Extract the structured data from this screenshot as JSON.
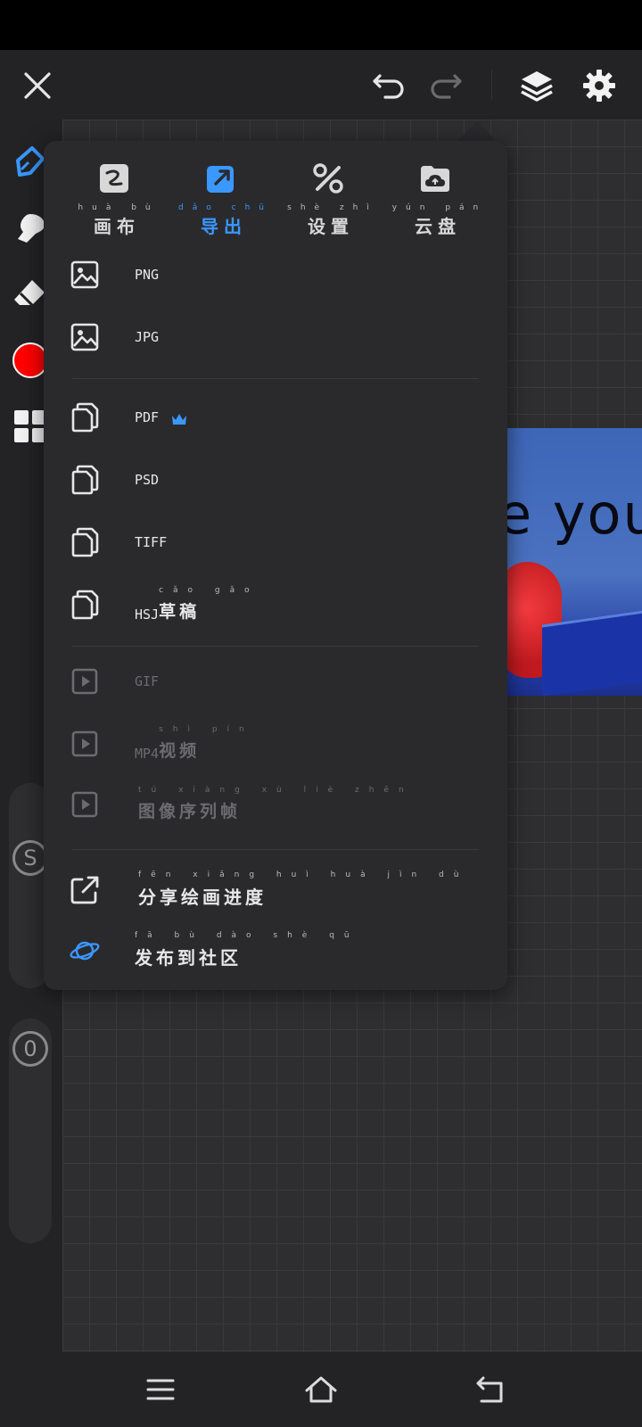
{
  "menu": {
    "tabs": [
      {
        "label": "画布",
        "pinyin": "huà bù",
        "active": false
      },
      {
        "label": "导出",
        "pinyin": "dǎo chū",
        "active": true
      },
      {
        "label": "设置",
        "pinyin": "shè zhì",
        "active": false
      },
      {
        "label": "云盘",
        "pinyin": "yún pán",
        "active": false
      }
    ],
    "items": {
      "png": "PNG",
      "jpg": "JPG",
      "pdf": "PDF",
      "psd": "PSD",
      "tiff": "TIFF",
      "hsj_prefix": "HSJ",
      "hsj_cjk": "草稿",
      "hsj_pinyin": "cǎo gǎo",
      "gif": "GIF",
      "mp4_prefix": "MP4",
      "mp4_cjk": "视频",
      "mp4_pinyin": "shì pín",
      "frames_cjk": "图像序列帧",
      "frames_pinyin": "tú xiàng xù liè zhēn",
      "share_cjk": "分享绘画进度",
      "share_pinyin": "fēn xiǎng huì huà jìn dù",
      "publish_cjk": "发布到社区",
      "publish_pinyin": "fā bù dào shè qū"
    }
  },
  "canvas": {
    "artwork_text": "e you"
  },
  "sliders": {
    "size_label": "S",
    "opacity_label": "0"
  },
  "colors": {
    "accent": "#3a98ff",
    "current_brush_color": "#ff0000",
    "panel_bg": "#2a2a2d",
    "toolbar_bg": "#232325"
  }
}
